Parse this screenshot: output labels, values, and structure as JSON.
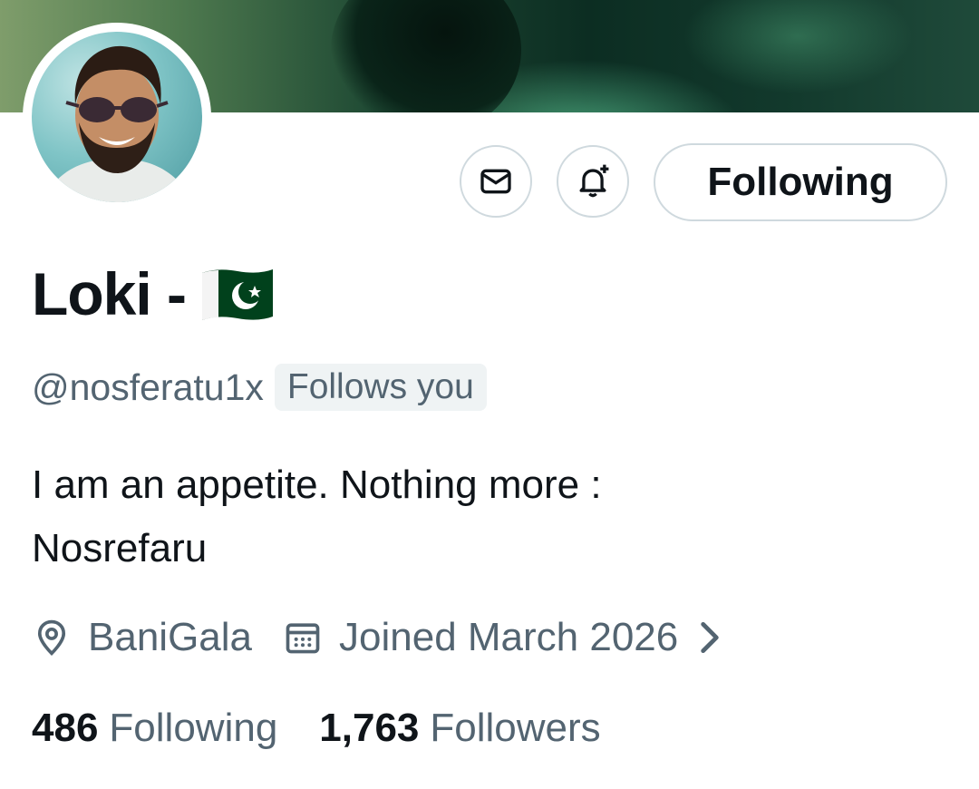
{
  "profile": {
    "display_name": "Loki -",
    "flag_icon": "pakistan-flag-icon",
    "handle": "@nosferatu1x",
    "follows_badge": "Follows you",
    "bio_line1": "I am an appetite. Nothing more :",
    "bio_line2": "Nosrefaru",
    "location": "BaniGala",
    "joined": "Joined March 2026"
  },
  "actions": {
    "following_label": "Following",
    "message_icon": "envelope-icon",
    "notify_icon": "bell-plus-icon"
  },
  "stats": {
    "following_count": "486",
    "following_label": "Following",
    "followers_count": "1,763",
    "followers_label": "Followers"
  },
  "colors": {
    "text_primary": "#0f1419",
    "text_secondary": "#536471",
    "border": "#cfd9de",
    "flag_green": "#01411c"
  }
}
